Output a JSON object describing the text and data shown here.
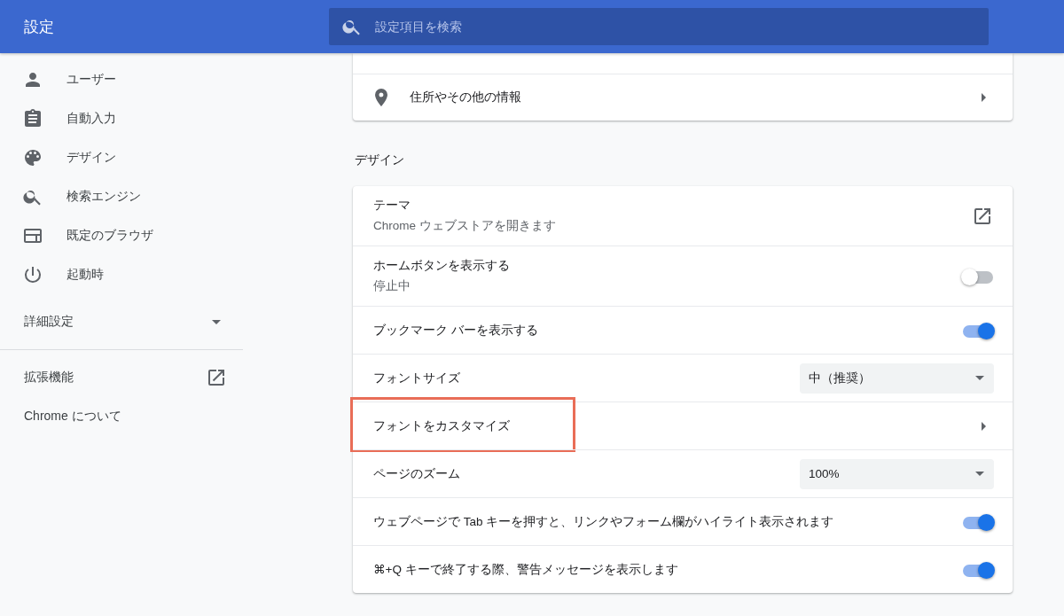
{
  "header": {
    "title": "設定",
    "search": {
      "placeholder": "設定項目を検索"
    }
  },
  "sidebar": {
    "items": [
      {
        "label": "ユーザー"
      },
      {
        "label": "自動入力"
      },
      {
        "label": "デザイン"
      },
      {
        "label": "検索エンジン"
      },
      {
        "label": "既定のブラウザ"
      },
      {
        "label": "起動時"
      }
    ],
    "advanced": {
      "label": "詳細設定",
      "expanded": false
    },
    "extensions": {
      "label": "拡張機能"
    },
    "about": {
      "label": "Chrome について"
    }
  },
  "autofill_card": {
    "rows": [
      {
        "label": "住所やその他の情報",
        "kind": "chevron"
      }
    ]
  },
  "sections": [
    {
      "title": "デザイン",
      "rows": [
        {
          "kind": "external",
          "label": "テーマ",
          "sublabel": "Chrome ウェブストアを開きます"
        },
        {
          "kind": "toggle",
          "label": "ホームボタンを表示する",
          "sublabel": "停止中",
          "on": false
        },
        {
          "kind": "toggle",
          "label": "ブックマーク バーを表示する",
          "on": true
        },
        {
          "kind": "select",
          "label": "フォントサイズ",
          "value": "中（推奨）"
        },
        {
          "kind": "chevron",
          "label": "フォントをカスタマイズ",
          "highlighted": true
        },
        {
          "kind": "select",
          "label": "ページのズーム",
          "value": "100%"
        },
        {
          "kind": "toggle",
          "label": "ウェブページで Tab キーを押すと、リンクやフォーム欄がハイライト表示されます",
          "on": true
        },
        {
          "kind": "toggle",
          "label": "⌘+Q キーで終了する際、警告メッセージを表示します",
          "on": true
        }
      ]
    }
  ]
}
